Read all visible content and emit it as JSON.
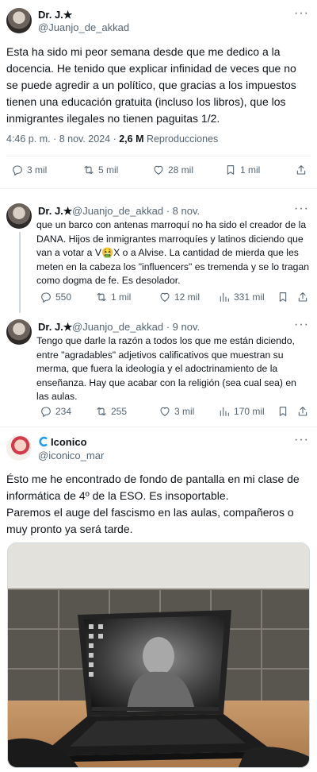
{
  "tweet1": {
    "name": "Dr. J.★",
    "handle": "@Juanjo_de_akkad",
    "text": "Esta ha sido mi peor semana desde que me dedico a la docencia. He tenido que explicar infinidad de veces que no se puede agredir a un político, que gracias a los impuestos tienen una educación gratuita (incluso los libros), que los inmigrantes ilegales no tienen paguitas 1/2.",
    "timestamp": "4:46 p. m. · 8 nov. 2024 · ",
    "views_count": "2,6 M",
    "views_label": " Reproducciones",
    "actions": {
      "replies": "3 mil",
      "reposts": "5 mil",
      "likes": "28 mil",
      "bookmarks": "1 mil"
    }
  },
  "reply1": {
    "name": "Dr. J.★",
    "handle": "@Juanjo_de_akkad · 8 nov.",
    "text": "que un barco con antenas marroquí no ha sido el creador de la DANA. Hijos de inmigrantes marroquíes y latinos diciendo que van a votar a V🤮X o a Alvise. La cantidad de mierda que les meten en la cabeza los \"influencers\" es tremenda y se lo tragan como dogma de fe. Es desolador.",
    "actions": {
      "replies": "550",
      "reposts": "1 mil",
      "likes": "12 mil",
      "views": "331 mil"
    }
  },
  "reply2": {
    "name": "Dr. J.★",
    "handle": "@Juanjo_de_akkad · 9 nov.",
    "text": "Tengo que darle la razón a todos los que me están diciendo, entre \"agradables\" adjetivos calificativos que muestran su merma, que fuera la ideología y el adoctrinamiento de la enseñanza. Hay que acabar con la religión (sea cual sea) en las aulas.",
    "actions": {
      "replies": "234",
      "reposts": "255",
      "likes": "3 mil",
      "views": "170 mil"
    }
  },
  "tweet2": {
    "name": "Iconico",
    "handle": "@iconico_mar",
    "text_lines": [
      "Ésto me he encontrado de fondo de pantalla en mi clase de informática de 4º de la ESO. Es insoportable.",
      "Paremos el auge del fascismo en las aulas, compañeros o muy pronto ya será tarde."
    ]
  },
  "colors": {
    "text": "#0f1419",
    "secondary": "#536471",
    "divider": "#eff3f4",
    "brand_blue": "#1d9bf0"
  },
  "icons": [
    "more-icon",
    "reply-icon",
    "repost-icon",
    "like-icon",
    "bookmark-icon",
    "share-icon",
    "views-icon"
  ]
}
